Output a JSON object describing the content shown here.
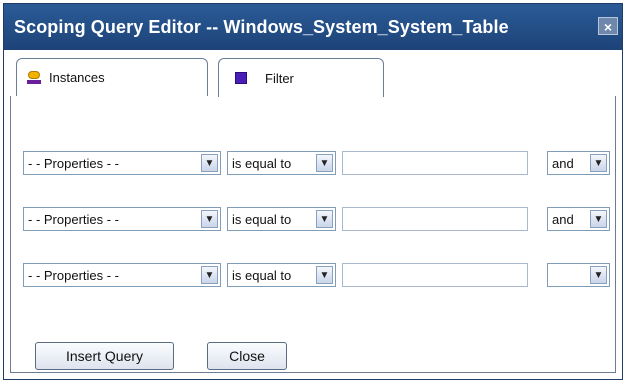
{
  "window": {
    "title": "Scoping Query Editor -- Windows_System_System_Table",
    "close_glyph": "×"
  },
  "tabs": [
    {
      "label": "Instances",
      "icon": "instances-icon"
    },
    {
      "label": "Filter",
      "icon": "filter-icon",
      "active": true
    }
  ],
  "filter_rows": [
    {
      "property": "- - Properties - -",
      "operator": "is equal to",
      "value": "",
      "conjunction": "and"
    },
    {
      "property": "- - Properties - -",
      "operator": "is equal to",
      "value": "",
      "conjunction": "and"
    },
    {
      "property": "- - Properties - -",
      "operator": "is equal to",
      "value": "",
      "conjunction": ""
    }
  ],
  "buttons": {
    "insert_label": "Insert Query",
    "close_label": "Close"
  },
  "dropdown_glyph": "▼",
  "colors": {
    "titlebar": "#1d4378",
    "border": "#6a7d95"
  }
}
